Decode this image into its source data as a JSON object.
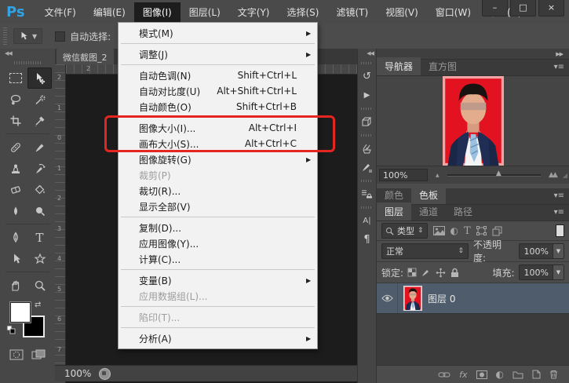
{
  "titlebar": {
    "logo": "Ps",
    "menus": [
      {
        "label": "文件(F)"
      },
      {
        "label": "编辑(E)"
      },
      {
        "label": "图像(I)",
        "active": true
      },
      {
        "label": "图层(L)"
      },
      {
        "label": "文字(Y)"
      },
      {
        "label": "选择(S)"
      },
      {
        "label": "滤镜(T)"
      },
      {
        "label": "视图(V)"
      },
      {
        "label": "窗口(W)"
      },
      {
        "label": "帮助(H)"
      }
    ],
    "window_controls": {
      "minimize": "–",
      "maximize": "□",
      "close": "×"
    }
  },
  "options_bar": {
    "tool_name": "move-tool",
    "auto_select_label": "自动选择:"
  },
  "image_menu": {
    "items": [
      {
        "label": "模式(M)",
        "submenu": true
      },
      {
        "sep": true
      },
      {
        "label": "调整(J)",
        "submenu": true
      },
      {
        "sep": true
      },
      {
        "label": "自动色调(N)",
        "shortcut": "Shift+Ctrl+L"
      },
      {
        "label": "自动对比度(U)",
        "shortcut": "Alt+Shift+Ctrl+L"
      },
      {
        "label": "自动颜色(O)",
        "shortcut": "Shift+Ctrl+B"
      },
      {
        "sep": true
      },
      {
        "label": "图像大小(I)...",
        "shortcut": "Alt+Ctrl+I"
      },
      {
        "label": "画布大小(S)...",
        "shortcut": "Alt+Ctrl+C"
      },
      {
        "label": "图像旋转(G)",
        "submenu": true
      },
      {
        "label": "裁剪(P)",
        "disabled": true
      },
      {
        "label": "裁切(R)..."
      },
      {
        "label": "显示全部(V)"
      },
      {
        "sep": true
      },
      {
        "label": "复制(D)..."
      },
      {
        "label": "应用图像(Y)..."
      },
      {
        "label": "计算(C)..."
      },
      {
        "sep": true
      },
      {
        "label": "变量(B)",
        "submenu": true
      },
      {
        "label": "应用数据组(L)...",
        "disabled": true
      },
      {
        "sep": true
      },
      {
        "label": "陷印(T)...",
        "disabled": true
      },
      {
        "sep": true
      },
      {
        "label": "分析(A)",
        "submenu": true
      }
    ]
  },
  "annotation": {
    "highlight_color": "#e52620",
    "highlighted_item": "图像大小(I)..."
  },
  "toolbar": {
    "tools": [
      "rectangular-marquee",
      "move",
      "lasso",
      "magic-wand",
      "crop",
      "eyedropper",
      "healing-brush",
      "brush",
      "clone-stamp",
      "history-brush",
      "eraser",
      "paint-bucket",
      "blur",
      "dodge",
      "pen",
      "type",
      "path-select",
      "custom-shape",
      "hand",
      "zoom"
    ],
    "foreground_color": "#ffffff",
    "background_color": "#000000"
  },
  "canvas": {
    "doc_tab": "微信截图_2",
    "h_ruler_label": "2",
    "v_ruler": [
      "2",
      "1",
      "0",
      "1",
      "2",
      "3",
      "4",
      "5",
      "6",
      "7"
    ],
    "status_zoom": "100%"
  },
  "icon_dock": {
    "items": [
      "history-panel",
      "actions-panel",
      "3d-panel",
      "brush-presets-panel",
      "brush-panel",
      "clone-source-panel",
      "character-panel",
      "paragraph-panel"
    ]
  },
  "panels": {
    "navigator": {
      "tabs": [
        "导航器",
        "直方图"
      ],
      "active_tab": "导航器",
      "zoom": "100%"
    },
    "colors": {
      "tabs": [
        "颜色",
        "色板"
      ],
      "active_tab": "色板"
    },
    "layers": {
      "tabs": [
        "图层",
        "通道",
        "路径"
      ],
      "active_tab": "图层",
      "filter_label": "类型",
      "blend_mode": "正常",
      "opacity_label": "不透明度:",
      "opacity_value": "100%",
      "lock_label": "锁定:",
      "fill_label": "填充:",
      "fill_value": "100%",
      "rows": [
        {
          "name": "图层 0",
          "visible": true
        }
      ],
      "fx_label": "fx"
    }
  },
  "icons": {
    "submenu_arrow": "▶",
    "dropdown_caret": "▼",
    "updown": "⇕",
    "collapse_left": "◀◀",
    "collapse_right": "▶▶",
    "panel_menu": "▾≡",
    "swap_colors": "⇄",
    "history": "↺",
    "actions": "▶",
    "character": "A|",
    "paragraph": "¶",
    "slider_thumb": "▲",
    "zoom_out_mountains": "▲",
    "zoom_in_mountains": "▲▲",
    "adjustment": "◐",
    "grip_corner": "◢"
  }
}
